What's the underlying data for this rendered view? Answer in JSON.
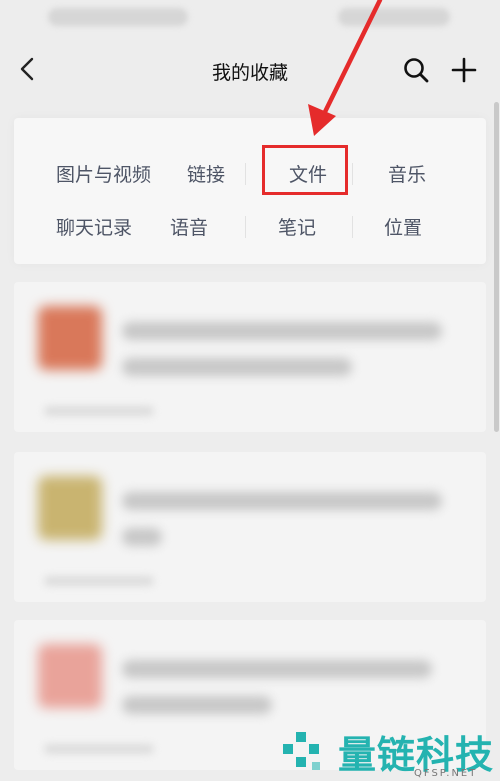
{
  "header": {
    "title": "我的收藏"
  },
  "categories": {
    "row1": [
      "图片与视频",
      "链接",
      "文件",
      "音乐"
    ],
    "row2": [
      "聊天记录",
      "语音",
      "笔记",
      "位置"
    ]
  },
  "annotation": {
    "color": "#e52b2b",
    "highlighted_item": "文件"
  },
  "icons": {
    "back": "chevron-left-icon",
    "search": "search-icon",
    "add": "plus-icon"
  },
  "watermark": {
    "text": "量链科技",
    "sub": "QFSP.NET",
    "color": "#24b3b0"
  }
}
